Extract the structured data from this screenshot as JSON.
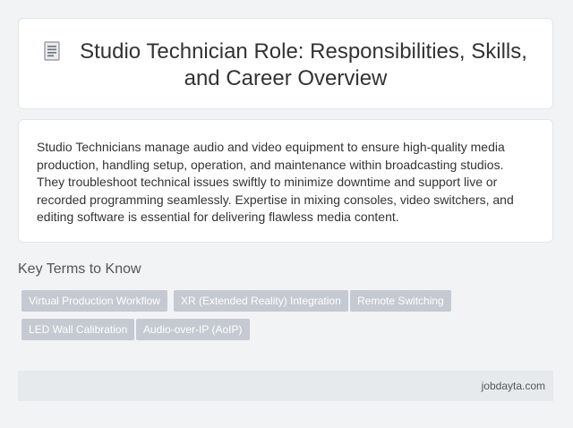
{
  "header": {
    "icon": "document-icon",
    "title_line1": "Studio Technician Role: Responsibilities, Skills,",
    "title_line2": "and Career Overview"
  },
  "description": "Studio Technicians manage audio and video equipment to ensure high-quality media production, handling setup, operation, and maintenance within broadcasting studios. They troubleshoot technical issues swiftly to minimize downtime and support live or recorded programming seamlessly. Expertise in mixing consoles, video switchers, and editing software is essential for delivering flawless media content.",
  "key_terms": {
    "heading": "Key Terms to Know",
    "tags": [
      "Virtual Production Workflow",
      "XR (Extended Reality) Integration",
      "Remote Switching",
      "LED Wall Calibration",
      "Audio-over-IP (AoIP)"
    ]
  },
  "footer": {
    "site": "jobdayta.com"
  },
  "colors": {
    "tag_bg": "#c5c9d2",
    "footer_bg": "#e6eaec"
  }
}
